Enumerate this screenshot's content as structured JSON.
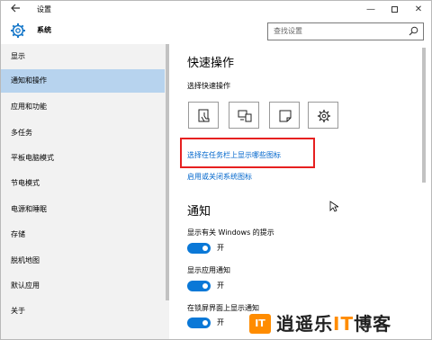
{
  "window": {
    "title": "设置",
    "back_icon": "back-arrow-icon",
    "minimize_glyph": "—",
    "close_glyph": "✕"
  },
  "header": {
    "title": "系统",
    "icon": "gear-icon",
    "search_placeholder": "查找设置"
  },
  "sidebar": {
    "items": [
      {
        "label": "显示",
        "selected": false
      },
      {
        "label": "通知和操作",
        "selected": true
      },
      {
        "label": "应用和功能",
        "selected": false
      },
      {
        "label": "多任务",
        "selected": false
      },
      {
        "label": "平板电脑模式",
        "selected": false
      },
      {
        "label": "节电模式",
        "selected": false
      },
      {
        "label": "电源和睡眠",
        "selected": false
      },
      {
        "label": "存储",
        "selected": false
      },
      {
        "label": "脱机地图",
        "selected": false
      },
      {
        "label": "默认应用",
        "selected": false
      },
      {
        "label": "关于",
        "selected": false
      }
    ]
  },
  "main": {
    "quick_actions": {
      "title": "快速操作",
      "subtitle": "选择快速操作",
      "tiles": [
        {
          "icon": "tablet-mode-icon"
        },
        {
          "icon": "connect-display-icon"
        },
        {
          "icon": "note-icon"
        },
        {
          "icon": "settings-icon"
        }
      ],
      "taskbar_icons_link": "选择在任务栏上显示哪些图标",
      "system_icons_link": "启用或关闭系统图标"
    },
    "notifications": {
      "title": "通知",
      "settings": [
        {
          "label": "显示有关 Windows 的提示",
          "state": "开",
          "on": true
        },
        {
          "label": "显示应用通知",
          "state": "开",
          "on": true
        },
        {
          "label": "在锁屏界面上显示通知",
          "state": "开",
          "on": true
        }
      ]
    }
  },
  "watermark": {
    "logo_text": "IT",
    "text_pre": "逍遥乐",
    "text_it": "IT",
    "text_post": "博客"
  },
  "colors": {
    "accent": "#0a78d7",
    "link": "#0066cc",
    "sidebar_selected": "#b7d3ee",
    "highlight": "#e62020",
    "watermark_orange": "#ff8c00"
  }
}
